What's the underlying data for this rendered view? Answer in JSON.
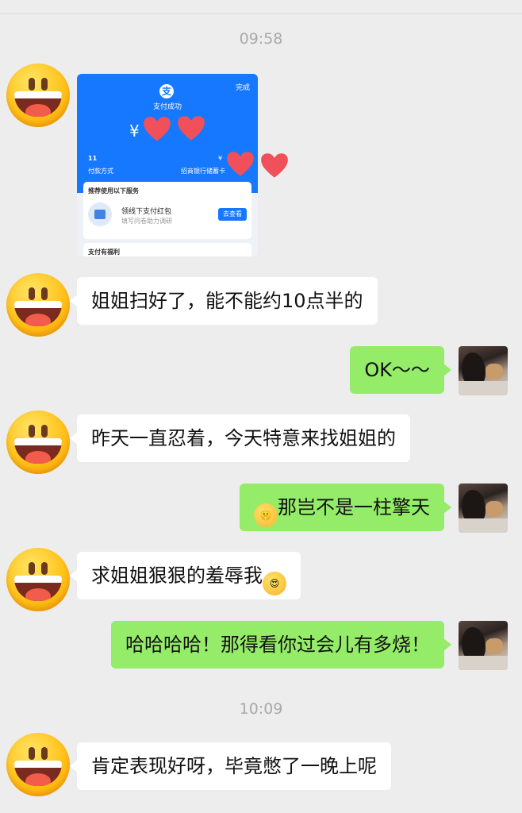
{
  "timestamps": [
    "09:58",
    "10:09"
  ],
  "receipt": {
    "done": "完成",
    "status": "支付成功",
    "currency": "¥",
    "method_value": "11",
    "method_label": "付款方式",
    "card_currency": "¥",
    "card_label": "招商银行储蓄卡",
    "services_title": "推荐使用以下服务",
    "service_name": "领线下支付红包",
    "service_desc": "填写问卷助力调研",
    "service_button": "去查看",
    "benefits_title": "支付有福利"
  },
  "messages": [
    {
      "side": "in",
      "text": "姐姐扫好了，能不能约10点半的"
    },
    {
      "side": "out",
      "text": "OK～～"
    },
    {
      "side": "in",
      "text": "昨天一直忍着，今天特意来找姐姐的"
    },
    {
      "side": "out",
      "emoji": "shushing-face-emoji",
      "text": "那岂不是一柱擎天"
    },
    {
      "side": "in",
      "text": "求姐姐狠狠的羞辱我",
      "emoji": "heart-eyes-emoji"
    },
    {
      "side": "out",
      "text": "哈哈哈哈！那得看你过会儿有多烧！"
    },
    {
      "side": "in",
      "text": "肯定表现好呀，毕竟憋了一晚上呢"
    }
  ],
  "colors": {
    "background": "#ededed",
    "incoming_bubble": "#ffffff",
    "outgoing_bubble": "#95ec69",
    "timestamp": "#a9a9a9",
    "receipt_blue": "#1677ff",
    "heart": "#f0505a"
  }
}
